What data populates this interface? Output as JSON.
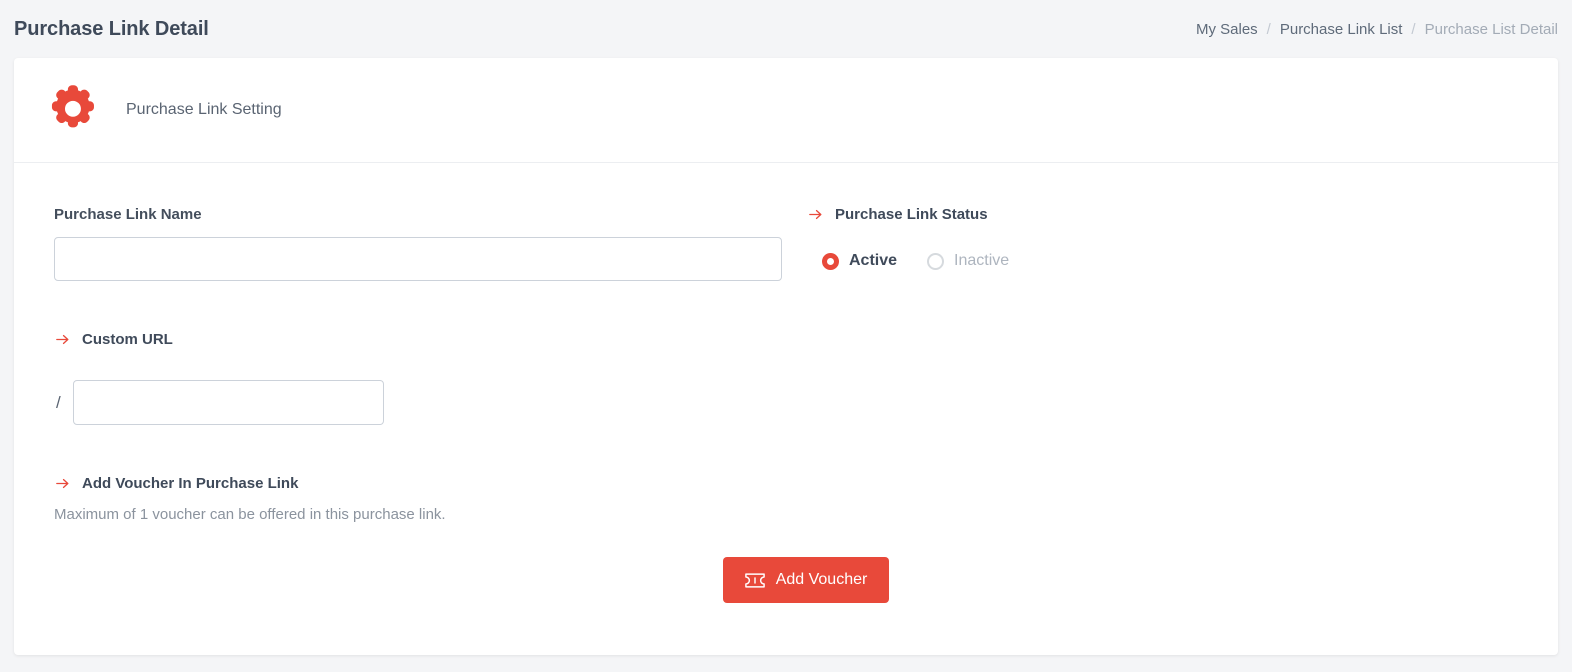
{
  "page": {
    "title": "Purchase Link Detail",
    "background_color": "#f4f5f7",
    "accent_color": "#e8493a"
  },
  "breadcrumb": {
    "separator": "/",
    "items": [
      {
        "label": "My Sales",
        "active": false
      },
      {
        "label": "Purchase Link List",
        "active": false
      },
      {
        "label": "Purchase List Detail",
        "active": true
      }
    ]
  },
  "card": {
    "header": {
      "icon": "gear-icon",
      "title": "Purchase Link Setting"
    },
    "purchase_link_name": {
      "label": "Purchase Link Name",
      "value": "",
      "placeholder": ""
    },
    "purchase_link_status": {
      "icon": "arrow-right-icon",
      "label": "Purchase Link Status",
      "selected": "Active",
      "options": [
        {
          "label": "Active",
          "selected": true
        },
        {
          "label": "Inactive",
          "selected": false
        }
      ]
    },
    "custom_url": {
      "icon": "arrow-right-icon",
      "label": "Custom URL",
      "prefix": "/",
      "value": "",
      "placeholder": ""
    },
    "add_voucher": {
      "icon": "arrow-right-icon",
      "label": "Add Voucher In Purchase Link",
      "note": "Maximum of 1 voucher can be offered in this purchase link.",
      "button_label": "Add Voucher",
      "button_icon": "ticket-icon"
    }
  }
}
